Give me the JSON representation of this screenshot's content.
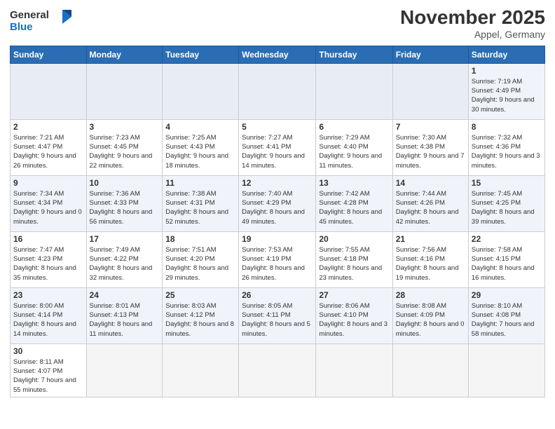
{
  "header": {
    "logo_general": "General",
    "logo_blue": "Blue",
    "month_title": "November 2025",
    "location": "Appel, Germany"
  },
  "weekdays": [
    "Sunday",
    "Monday",
    "Tuesday",
    "Wednesday",
    "Thursday",
    "Friday",
    "Saturday"
  ],
  "weeks": [
    [
      {
        "day": "",
        "info": ""
      },
      {
        "day": "",
        "info": ""
      },
      {
        "day": "",
        "info": ""
      },
      {
        "day": "",
        "info": ""
      },
      {
        "day": "",
        "info": ""
      },
      {
        "day": "",
        "info": ""
      },
      {
        "day": "1",
        "info": "Sunrise: 7:19 AM\nSunset: 4:49 PM\nDaylight: 9 hours and 30 minutes."
      }
    ],
    [
      {
        "day": "2",
        "info": "Sunrise: 7:21 AM\nSunset: 4:47 PM\nDaylight: 9 hours and 26 minutes."
      },
      {
        "day": "3",
        "info": "Sunrise: 7:23 AM\nSunset: 4:45 PM\nDaylight: 9 hours and 22 minutes."
      },
      {
        "day": "4",
        "info": "Sunrise: 7:25 AM\nSunset: 4:43 PM\nDaylight: 9 hours and 18 minutes."
      },
      {
        "day": "5",
        "info": "Sunrise: 7:27 AM\nSunset: 4:41 PM\nDaylight: 9 hours and 14 minutes."
      },
      {
        "day": "6",
        "info": "Sunrise: 7:29 AM\nSunset: 4:40 PM\nDaylight: 9 hours and 11 minutes."
      },
      {
        "day": "7",
        "info": "Sunrise: 7:30 AM\nSunset: 4:38 PM\nDaylight: 9 hours and 7 minutes."
      },
      {
        "day": "8",
        "info": "Sunrise: 7:32 AM\nSunset: 4:36 PM\nDaylight: 9 hours and 3 minutes."
      }
    ],
    [
      {
        "day": "9",
        "info": "Sunrise: 7:34 AM\nSunset: 4:34 PM\nDaylight: 9 hours and 0 minutes."
      },
      {
        "day": "10",
        "info": "Sunrise: 7:36 AM\nSunset: 4:33 PM\nDaylight: 8 hours and 56 minutes."
      },
      {
        "day": "11",
        "info": "Sunrise: 7:38 AM\nSunset: 4:31 PM\nDaylight: 8 hours and 52 minutes."
      },
      {
        "day": "12",
        "info": "Sunrise: 7:40 AM\nSunset: 4:29 PM\nDaylight: 8 hours and 49 minutes."
      },
      {
        "day": "13",
        "info": "Sunrise: 7:42 AM\nSunset: 4:28 PM\nDaylight: 8 hours and 45 minutes."
      },
      {
        "day": "14",
        "info": "Sunrise: 7:44 AM\nSunset: 4:26 PM\nDaylight: 8 hours and 42 minutes."
      },
      {
        "day": "15",
        "info": "Sunrise: 7:45 AM\nSunset: 4:25 PM\nDaylight: 8 hours and 39 minutes."
      }
    ],
    [
      {
        "day": "16",
        "info": "Sunrise: 7:47 AM\nSunset: 4:23 PM\nDaylight: 8 hours and 35 minutes."
      },
      {
        "day": "17",
        "info": "Sunrise: 7:49 AM\nSunset: 4:22 PM\nDaylight: 8 hours and 32 minutes."
      },
      {
        "day": "18",
        "info": "Sunrise: 7:51 AM\nSunset: 4:20 PM\nDaylight: 8 hours and 29 minutes."
      },
      {
        "day": "19",
        "info": "Sunrise: 7:53 AM\nSunset: 4:19 PM\nDaylight: 8 hours and 26 minutes."
      },
      {
        "day": "20",
        "info": "Sunrise: 7:55 AM\nSunset: 4:18 PM\nDaylight: 8 hours and 23 minutes."
      },
      {
        "day": "21",
        "info": "Sunrise: 7:56 AM\nSunset: 4:16 PM\nDaylight: 8 hours and 19 minutes."
      },
      {
        "day": "22",
        "info": "Sunrise: 7:58 AM\nSunset: 4:15 PM\nDaylight: 8 hours and 16 minutes."
      }
    ],
    [
      {
        "day": "23",
        "info": "Sunrise: 8:00 AM\nSunset: 4:14 PM\nDaylight: 8 hours and 14 minutes."
      },
      {
        "day": "24",
        "info": "Sunrise: 8:01 AM\nSunset: 4:13 PM\nDaylight: 8 hours and 11 minutes."
      },
      {
        "day": "25",
        "info": "Sunrise: 8:03 AM\nSunset: 4:12 PM\nDaylight: 8 hours and 8 minutes."
      },
      {
        "day": "26",
        "info": "Sunrise: 8:05 AM\nSunset: 4:11 PM\nDaylight: 8 hours and 5 minutes."
      },
      {
        "day": "27",
        "info": "Sunrise: 8:06 AM\nSunset: 4:10 PM\nDaylight: 8 hours and 3 minutes."
      },
      {
        "day": "28",
        "info": "Sunrise: 8:08 AM\nSunset: 4:09 PM\nDaylight: 8 hours and 0 minutes."
      },
      {
        "day": "29",
        "info": "Sunrise: 8:10 AM\nSunset: 4:08 PM\nDaylight: 7 hours and 58 minutes."
      }
    ],
    [
      {
        "day": "30",
        "info": "Sunrise: 8:11 AM\nSunset: 4:07 PM\nDaylight: 7 hours and 55 minutes."
      },
      {
        "day": "",
        "info": ""
      },
      {
        "day": "",
        "info": ""
      },
      {
        "day": "",
        "info": ""
      },
      {
        "day": "",
        "info": ""
      },
      {
        "day": "",
        "info": ""
      },
      {
        "day": "",
        "info": ""
      }
    ]
  ]
}
